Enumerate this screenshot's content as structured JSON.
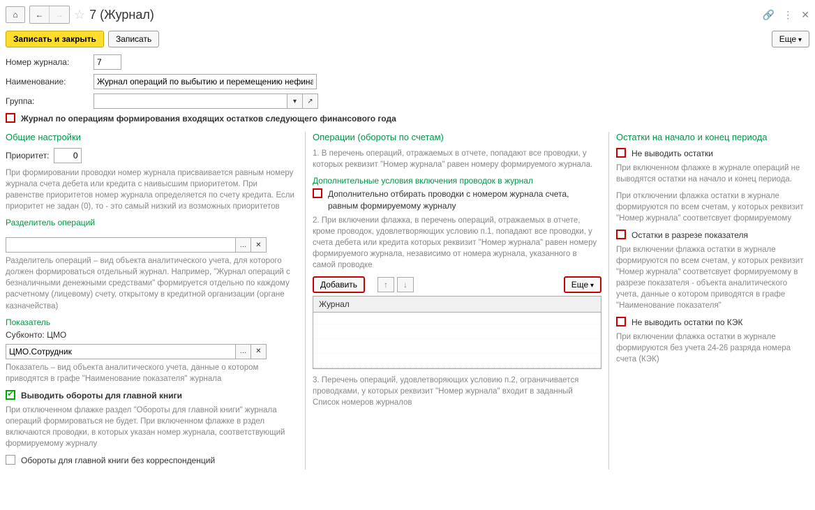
{
  "title": "7 (Журнал)",
  "toolbar": {
    "save_close": "Записать и закрыть",
    "save": "Записать",
    "more": "Еще"
  },
  "form": {
    "journal_no_label": "Номер журнала:",
    "journal_no_value": "7",
    "name_label": "Наименование:",
    "name_value": "Журнал операций по выбытию и перемещению нефинансовых а",
    "group_label": "Группа:",
    "incoming_balance_label": "Журнал по операциям формирования входящих остатков следующего финансового года"
  },
  "left": {
    "title": "Общие настройки",
    "priority_label": "Приоритет:",
    "priority_value": "0",
    "priority_help": "При формировании проводки номер журнала присваивается равным номеру журнала счета дебета или кредита с наивысшим приоритетом. При равенстве приоритетов номер журнала определяется по счету кредита. Если приоритет не задан (0), то - это самый низкий из возможных приоритетов",
    "separator_title": "Разделитель операций",
    "separator_help": "Разделитель операций – вид объекта аналитического учета, для которого должен формироваться отдельный журнал. Например, \"Журнал операций с безналичными денежными средствами\" формируется отдельно по каждому расчетному (лицевому) счету, открытому в кредитной организации (органе казначейства)",
    "indicator_title": "Показатель",
    "subkonto_label": "Субконто: ЦМО",
    "subkonto_value": "ЦМО.Сотрудник",
    "indicator_help": "Показатель – вид объекта аналитического учета, данные о котором приводятся в графе \"Наименование показателя\" журнала",
    "ledger_turnover_label": "Выводить обороты для главной книги",
    "ledger_turnover_help": "При отключенном флажке раздел \"Обороты для главной книги\" журнала операций формироваться не будет. При включенном флажке в рздел включаются проводки, в которых указан номер журнала, соответствующий формируемому журналу",
    "no_corr_label": "Обороты для главной книги без корреспонденций"
  },
  "mid": {
    "title": "Операции (обороты по счетам)",
    "p1": "1. В перечень операций, отражаемых в отчете, попадают все проводки, у которых реквизит \"Номер журнала\" равен номеру формируемого журнала.",
    "extra_cond_title": "Дополнительные условия включения проводок в журнал",
    "extra_filter_label": "Дополнительно отбирать проводки с номером журнала счета, равным формируемому журналу",
    "p2": "2. При включении флажка, в перечень операций, отражаемых в отчете, кроме проводок, удовлетворяющих условию п.1, попадают все проводки, у счета дебета или кредита которых реквизит \"Номер журнала\" равен номеру формируемого журнала, независимо от номера журнала, указанного в самой проводке",
    "add_btn": "Добавить",
    "more_btn": "Еще",
    "table_header": "Журнал",
    "p3": "3. Перечень операций, удовлетворяющих условию п.2, ограничивается проводками, у которых реквизит \"Номер журнала\" входит в заданный Список номеров журналов"
  },
  "right": {
    "title": "Остатки на начало и конец периода",
    "no_balances_label": "Не выводить остатки",
    "no_balances_help_on": "При включенном флажке в журнале операций не выводятся остатки на начало и конец периода.",
    "no_balances_help_off": "При отключении флажка остатки в журнале формируются по всем счетам, у которых реквизит \"Номер журнала\" соответсвует формируемому",
    "by_indicator_label": "Остатки в разрезе показателя",
    "by_indicator_help": "При включении флажка остатки в журнале формируются по всем счетам, у которых реквизит \"Номер журнала\" соответсвует формируемому в разрезе показателя - объекта аналитического учета, данные о котором приводятся в графе \"Наименование показателя\"",
    "no_kek_label": "Не выводить остатки по КЭК",
    "no_kek_help": "При включении флажка остатки в журнале формируются без учета 24-26 разряда номера счета (КЭК)"
  }
}
